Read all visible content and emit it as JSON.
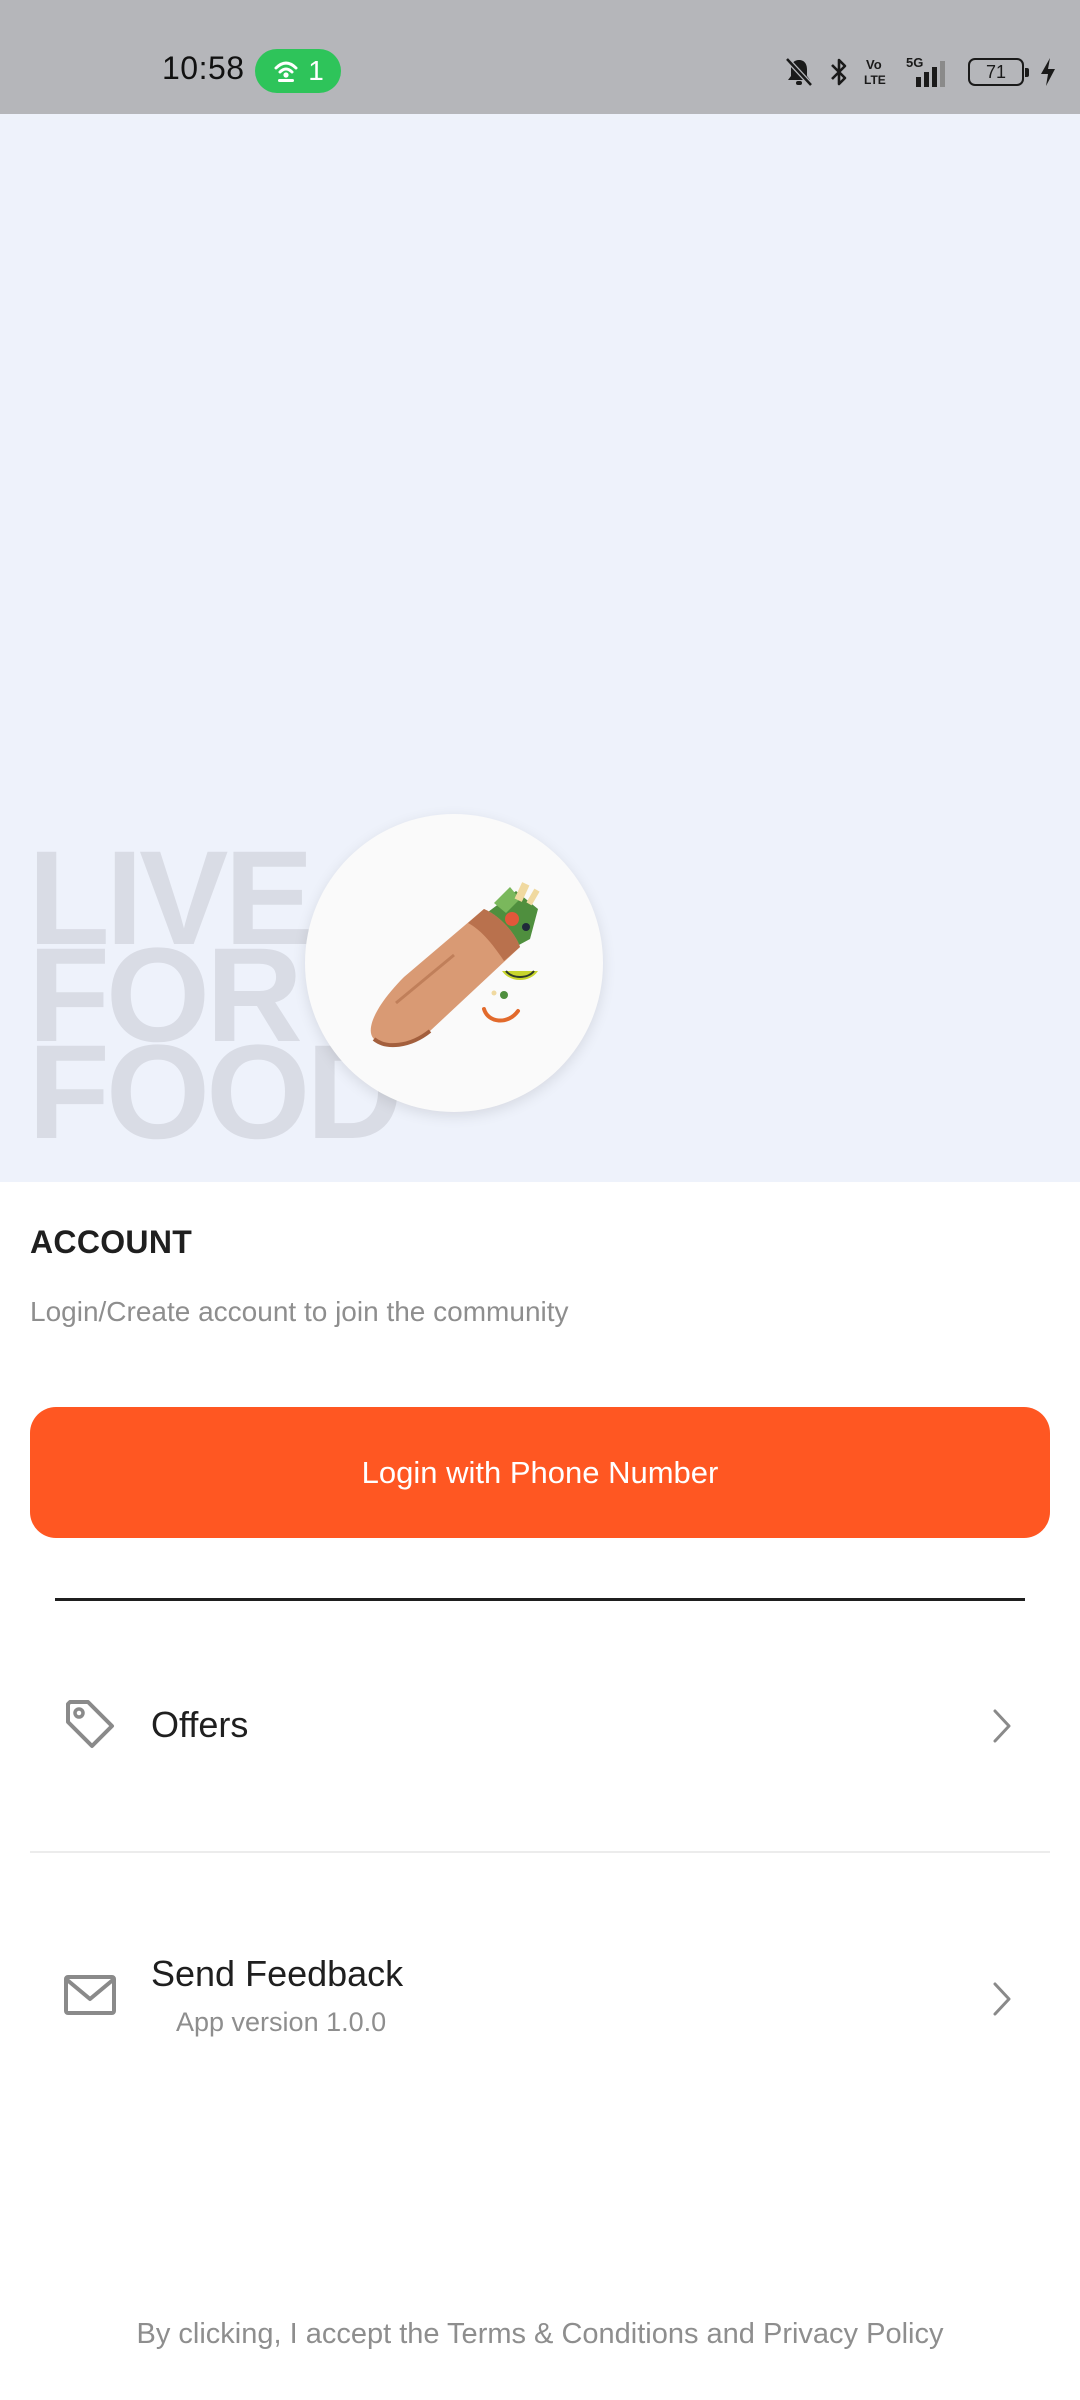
{
  "status_bar": {
    "time": "10:58",
    "hotspot_count": "1",
    "battery_level": "71",
    "network_label": "5G",
    "volte_label": "Vo LTE",
    "icons": [
      "hotspot-icon",
      "mute-icon",
      "bluetooth-icon",
      "volte-icon",
      "signal-5g-icon",
      "battery-icon",
      "charging-icon"
    ]
  },
  "hero": {
    "tagline_lines": [
      "LIVE",
      "FOR",
      "FOOD"
    ],
    "avatar_icon": "burrito-illustration"
  },
  "account": {
    "title": "ACCOUNT",
    "subtitle": "Login/Create account to join the community",
    "login_button_label": "Login with Phone Number"
  },
  "menu": {
    "offers": {
      "label": "Offers",
      "icon": "tag-icon"
    },
    "feedback": {
      "label": "Send Feedback",
      "sublabel": "App version 1.0.0",
      "icon": "mail-icon"
    }
  },
  "footer": {
    "terms_text": "By clicking, I accept the Terms & Conditions and Privacy Policy"
  },
  "colors": {
    "status_bar_bg": "#b5b6ba",
    "hero_bg": "#eef2fb",
    "accent": "#ff5722",
    "hotspot_pill": "#2ec45a",
    "muted_text": "#8e8e8e",
    "primary_text": "#1f1f1f"
  }
}
